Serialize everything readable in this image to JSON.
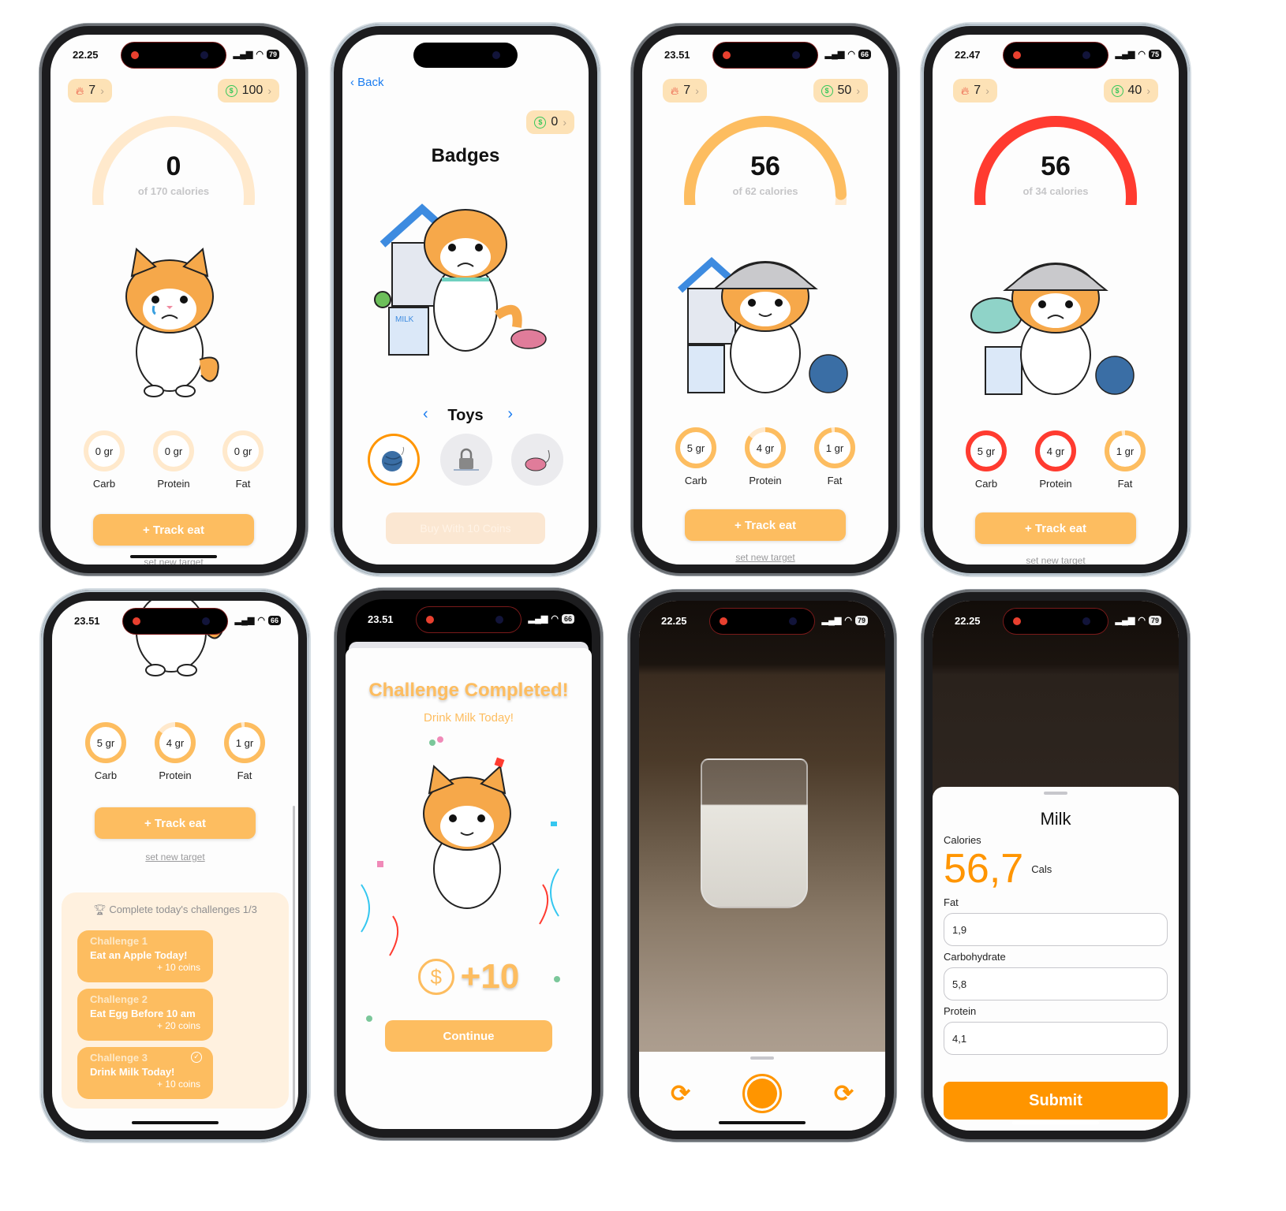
{
  "screens": {
    "home_empty": {
      "time": "22.25",
      "battery": "79",
      "streak": "7",
      "coins": "100",
      "calories": "0",
      "calories_target": "of 170 calories",
      "calories_progress": 0.0,
      "macros": [
        {
          "value": "0 gr",
          "label": "Carb",
          "progress": 0.0,
          "over": false
        },
        {
          "value": "0 gr",
          "label": "Protein",
          "progress": 0.0,
          "over": false
        },
        {
          "value": "0 gr",
          "label": "Fat",
          "progress": 0.0,
          "over": false
        }
      ],
      "track_button": "+ Track eat",
      "set_target": "set new target",
      "cat_mood": "sad"
    },
    "badges": {
      "back": "Back",
      "coins": "0",
      "title": "Badges",
      "category": "Toys",
      "toys": [
        {
          "name": "yarn-ball",
          "selected": true,
          "locked": false
        },
        {
          "name": "locked-toy",
          "selected": false,
          "locked": true
        },
        {
          "name": "toy-mouse",
          "selected": false,
          "locked": false
        }
      ],
      "buy_button": "Buy With 10 Coins"
    },
    "home_near": {
      "time": "23.51",
      "battery": "66",
      "streak": "7",
      "coins": "50",
      "calories": "56",
      "calories_target": "of 62 calories",
      "calories_progress": 0.9,
      "macros": [
        {
          "value": "5 gr",
          "label": "Carb",
          "progress": 1.0,
          "over": false
        },
        {
          "value": "4 gr",
          "label": "Protein",
          "progress": 0.85,
          "over": false
        },
        {
          "value": "1 gr",
          "label": "Fat",
          "progress": 0.97,
          "over": false
        }
      ],
      "track_button": "+ Track eat",
      "set_target": "set new target",
      "cat_mood": "happy"
    },
    "home_over": {
      "time": "22.47",
      "battery": "75",
      "streak": "7",
      "coins": "40",
      "calories": "56",
      "calories_target": "of 34 calories",
      "calories_progress": 1.0,
      "macros": [
        {
          "value": "5 gr",
          "label": "Carb",
          "progress": 1.0,
          "over": true
        },
        {
          "value": "4 gr",
          "label": "Protein",
          "progress": 1.0,
          "over": true
        },
        {
          "value": "1 gr",
          "label": "Fat",
          "progress": 0.97,
          "over": false
        }
      ],
      "track_button": "+ Track eat",
      "set_target": "set new target",
      "cat_mood": "sad"
    },
    "home_scrolled": {
      "time": "23.51",
      "battery": "66",
      "macros": [
        {
          "value": "5 gr",
          "label": "Carb",
          "progress": 1.0,
          "over": false
        },
        {
          "value": "4 gr",
          "label": "Protein",
          "progress": 0.85,
          "over": false
        },
        {
          "value": "1 gr",
          "label": "Fat",
          "progress": 0.97,
          "over": false
        }
      ],
      "track_button": "+ Track eat",
      "set_target": "set new target",
      "challenges_header": "Complete today's challenges 1/3",
      "challenges": [
        {
          "number": "Challenge 1",
          "title": "Eat an Apple Today!",
          "reward": "+ 10 coins",
          "done": false
        },
        {
          "number": "Challenge 2",
          "title": "Eat Egg Before 10 am",
          "reward": "+ 20 coins",
          "done": false
        },
        {
          "number": "Challenge 3",
          "title": "Drink Milk Today!",
          "reward": "+ 10 coins",
          "done": true
        }
      ]
    },
    "challenge_complete": {
      "time": "23.51",
      "battery": "66",
      "title": "Challenge Completed!",
      "subtitle": "Drink Milk Today!",
      "reward": "+10",
      "continue": "Continue"
    },
    "camera": {
      "time": "22.25",
      "battery": "79"
    },
    "food_result": {
      "time": "22.25",
      "battery": "79",
      "food_name": "Milk",
      "calories_label": "Calories",
      "calories_value": "56,7",
      "calories_unit": "Cals",
      "fat_label": "Fat",
      "fat_value": "1,9",
      "carb_label": "Carbohydrate",
      "carb_value": "5,8",
      "protein_label": "Protein",
      "protein_value": "4,1",
      "submit": "Submit"
    }
  },
  "colors": {
    "accent": "#fdbd60",
    "accent_light": "#ffe9cc",
    "over": "#ff3b30",
    "primary_orange": "#ff9500",
    "pill_bg": "#fde2b6",
    "link_blue": "#1a7cf0",
    "coin_green": "#34c759"
  }
}
